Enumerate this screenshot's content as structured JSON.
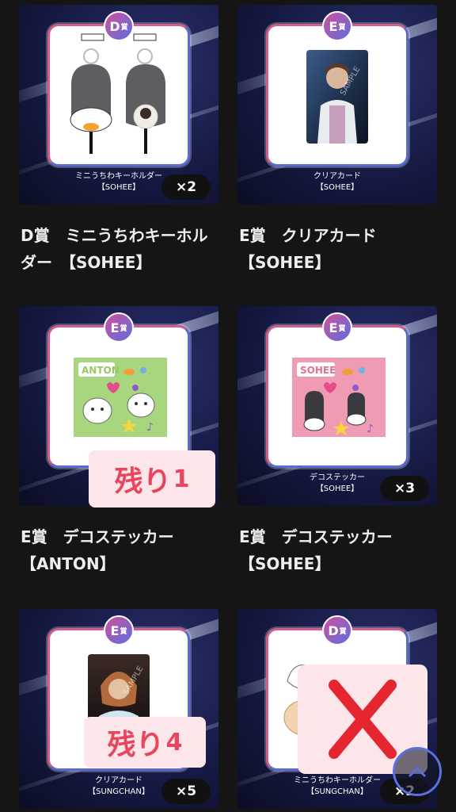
{
  "items": [
    {
      "grade": "D",
      "grade_suffix": "賞",
      "caption_line1": "ミニうちわキーホルダー",
      "caption_line2": "【SOHEE】",
      "quantity": "×2",
      "title": "D賞　ミニうちわキーホルダー　【SOHEE】"
    },
    {
      "grade": "E",
      "grade_suffix": "賞",
      "caption_line1": "クリアカード",
      "caption_line2": "【SOHEE】",
      "quantity": "",
      "title": "E賞　クリアカード　【SOHEE】",
      "watermark": "SAMPLE"
    },
    {
      "grade": "E",
      "grade_suffix": "賞",
      "caption_line1": "",
      "caption_line2": "",
      "quantity": "",
      "title": "E賞　デコステッカー　【ANTON】",
      "sticker_label": "ANTON",
      "remaining_label": "残り",
      "remaining_count": "1"
    },
    {
      "grade": "E",
      "grade_suffix": "賞",
      "caption_line1": "デコステッカー",
      "caption_line2": "【SOHEE】",
      "quantity": "×3",
      "title": "E賞　デコステッカー　【SOHEE】",
      "sticker_label": "SOHEE"
    },
    {
      "grade": "E",
      "grade_suffix": "賞",
      "caption_line1": "クリアカード",
      "caption_line2": "【SUNGCHAN】",
      "quantity": "×5",
      "remaining_label": "残り",
      "remaining_count": "4",
      "watermark": "SAMPLE"
    },
    {
      "grade": "D",
      "grade_suffix": "賞",
      "caption_line1": "ミニうちわキーホルダー",
      "caption_line2": "【SUNGCHAN】",
      "quantity": "×2",
      "sold_out_icon": "cross-mark-icon"
    }
  ],
  "colors": {
    "background": "#151515",
    "remaining_bg": "#fde6ea",
    "remaining_text": "#e8455f",
    "sold_out_x": "#e5252f",
    "badge_pink": "#d0509b",
    "badge_blue": "#5a6fe0"
  },
  "scroll_top_icon": "chevron-up-icon"
}
